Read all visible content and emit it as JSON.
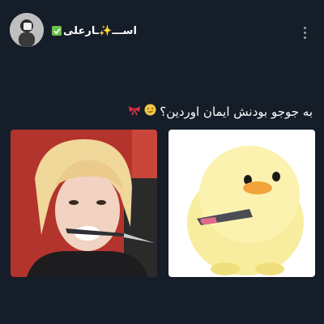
{
  "post": {
    "author_name": "اســـ✨ـارعلی",
    "verified_label": "✓",
    "caption": "به جوجو بودنش ایمان اوردین؟"
  },
  "icons": {
    "avatar": "avatar",
    "verified": "verified-icon",
    "more": "more-options-icon",
    "ribbon": "ribbon-emoji-icon",
    "face": "smiling-face-emoji-icon"
  },
  "media": {
    "left": {
      "label": "person-with-knife-photo"
    },
    "right": {
      "label": "yellow-chick-plush-with-knife-photo"
    }
  },
  "colors": {
    "background": "#151d29",
    "text": "#ffffff",
    "verified": "#6cc24a"
  }
}
